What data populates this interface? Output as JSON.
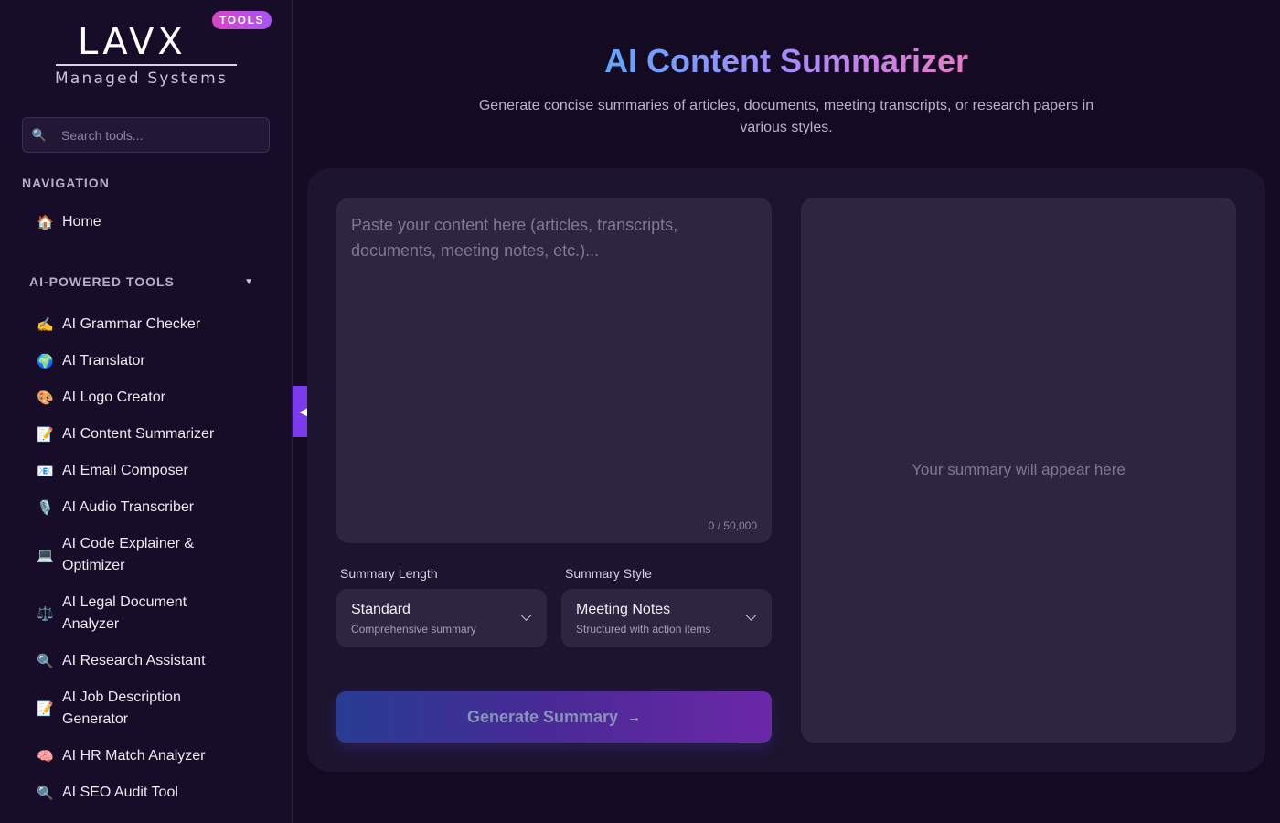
{
  "brand": {
    "logo_text": "LAVX",
    "logo_subtitle": "Managed Systems",
    "badge": "TOOLS"
  },
  "search": {
    "placeholder": "Search tools..."
  },
  "navigation": {
    "heading": "NAVIGATION",
    "items": [
      {
        "icon": "home-icon",
        "emoji": "🏠",
        "label": "Home"
      }
    ]
  },
  "tools": {
    "heading": "AI-POWERED TOOLS",
    "items": [
      {
        "icon": "writing-hand-icon",
        "emoji": "✍️",
        "label": "AI Grammar Checker"
      },
      {
        "icon": "globe-icon",
        "emoji": "🌍",
        "label": "AI Translator"
      },
      {
        "icon": "palette-icon",
        "emoji": "🎨",
        "label": "AI Logo Creator"
      },
      {
        "icon": "memo-icon",
        "emoji": "📝",
        "label": "AI Content Summarizer"
      },
      {
        "icon": "email-icon",
        "emoji": "📧",
        "label": "AI Email Composer"
      },
      {
        "icon": "microphone-icon",
        "emoji": "🎙️",
        "label": "AI Audio Transcriber"
      },
      {
        "icon": "laptop-icon",
        "emoji": "💻",
        "label": "AI Code Explainer & Optimizer"
      },
      {
        "icon": "scales-icon",
        "emoji": "⚖️",
        "label": "AI Legal Document Analyzer"
      },
      {
        "icon": "magnifier-icon",
        "emoji": "🔍",
        "label": "AI Research Assistant"
      },
      {
        "icon": "memo-icon",
        "emoji": "📝",
        "label": "AI Job Description Generator"
      },
      {
        "icon": "brain-icon",
        "emoji": "🧠",
        "label": "AI HR Match Analyzer"
      },
      {
        "icon": "magnifier-icon",
        "emoji": "🔍",
        "label": "AI SEO Audit Tool"
      }
    ]
  },
  "page": {
    "title": "AI Content Summarizer",
    "subtitle": "Generate concise summaries of articles, documents, meeting transcripts, or research papers in various styles."
  },
  "editor": {
    "placeholder": "Paste your content here (articles, transcripts, documents, meeting notes, etc.)...",
    "char_count": "0 / 50,000"
  },
  "options": {
    "length": {
      "label": "Summary Length",
      "value": "Standard",
      "description": "Comprehensive summary"
    },
    "style": {
      "label": "Summary Style",
      "value": "Meeting Notes",
      "description": "Structured with action items"
    }
  },
  "generate_button": {
    "label": "Generate Summary",
    "arrow": "→"
  },
  "output": {
    "placeholder": "Your summary will appear here"
  },
  "colors": {
    "background": "#140b23",
    "sidebar": "#170d29",
    "panel": "#1d1430",
    "field": "#2d2640",
    "accent": "#7c3aed",
    "badge": "#d946c3"
  }
}
